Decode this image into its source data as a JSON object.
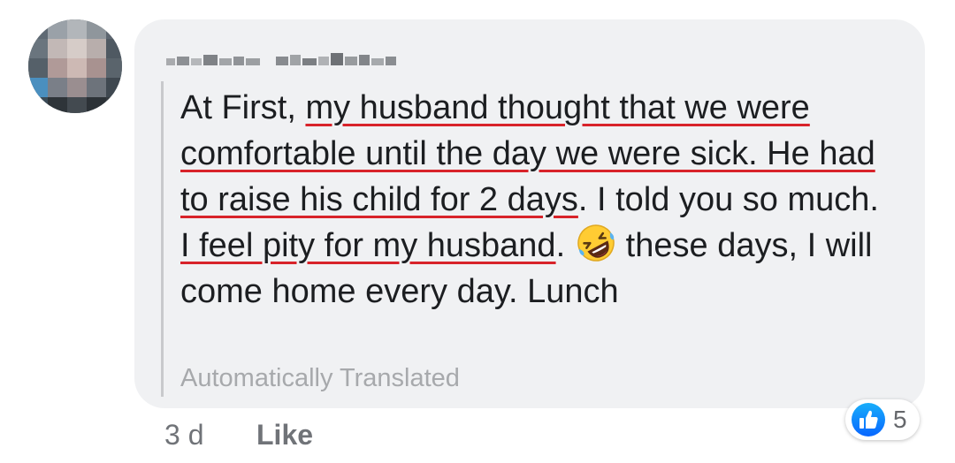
{
  "comment": {
    "text_part_1": "At First, ",
    "text_underlined_1": "my husband thought that we were comfortable until the day we were sick. He had to raise his child for 2 days",
    "text_part_2": ". I told you so much. ",
    "text_underlined_2": "I feel pity for my husband",
    "text_part_3": ".",
    "emoji": "rolling-on-floor-laughing-emoji",
    "text_part_4": " these days, I will come home every day. Lunch",
    "translation_note": "Automatically Translated"
  },
  "meta": {
    "time": "3 d",
    "like_label": "Like"
  },
  "reactions": {
    "icon": "thumbs-up-icon",
    "count": "5"
  },
  "colors": {
    "bubble": "#f0f1f3",
    "text": "#1c1e21",
    "underline": "#d8232a",
    "muted": "#707378",
    "like_blue": "#1877f2"
  }
}
